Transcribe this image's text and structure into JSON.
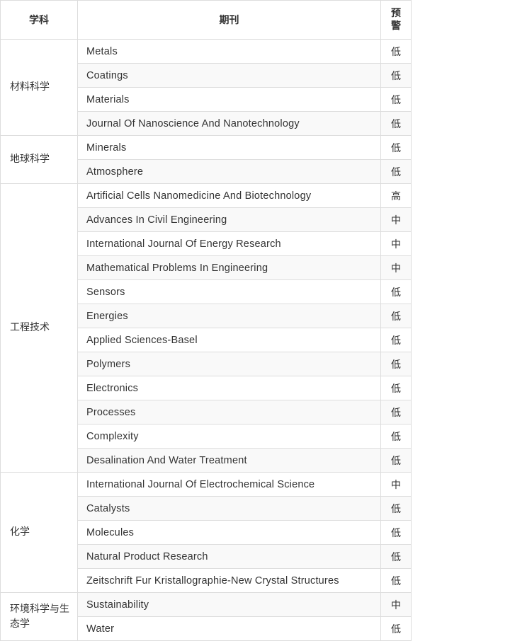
{
  "header": {
    "subject": "学科",
    "journal": "期刊",
    "warning": "预警"
  },
  "groups": [
    {
      "subject": "材料科学",
      "rows": [
        {
          "journal": "Metals",
          "level": "低"
        },
        {
          "journal": "Coatings",
          "level": "低"
        },
        {
          "journal": "Materials",
          "level": "低"
        },
        {
          "journal": "Journal Of Nanoscience And Nanotechnology",
          "level": "低"
        }
      ]
    },
    {
      "subject": "地球科学",
      "rows": [
        {
          "journal": "Minerals",
          "level": "低"
        },
        {
          "journal": "Atmosphere",
          "level": "低"
        }
      ]
    },
    {
      "subject": "工程技术",
      "rows": [
        {
          "journal": "Artificial Cells Nanomedicine And Biotechnology",
          "level": "高"
        },
        {
          "journal": "Advances In Civil Engineering",
          "level": "中"
        },
        {
          "journal": "International Journal Of Energy Research",
          "level": "中"
        },
        {
          "journal": "Mathematical Problems In Engineering",
          "level": "中"
        },
        {
          "journal": "Sensors",
          "level": "低"
        },
        {
          "journal": "Energies",
          "level": "低"
        },
        {
          "journal": "Applied Sciences-Basel",
          "level": "低"
        },
        {
          "journal": "Polymers",
          "level": "低"
        },
        {
          "journal": "Electronics",
          "level": "低"
        },
        {
          "journal": "Processes",
          "level": "低"
        },
        {
          "journal": "Complexity",
          "level": "低"
        },
        {
          "journal": "Desalination And Water Treatment",
          "level": "低"
        }
      ]
    },
    {
      "subject": "化学",
      "rows": [
        {
          "journal": "International Journal Of Electrochemical Science",
          "level": "中"
        },
        {
          "journal": "Catalysts",
          "level": "低"
        },
        {
          "journal": "Molecules",
          "level": "低"
        },
        {
          "journal": "Natural Product Research",
          "level": "低"
        },
        {
          "journal": "Zeitschrift Fur Kristallographie-New Crystal Structures",
          "level": "低"
        }
      ]
    },
    {
      "subject": "环境科学与生态学",
      "rows": [
        {
          "journal": "Sustainability",
          "level": "中"
        },
        {
          "journal": "Water",
          "level": "低"
        }
      ]
    }
  ]
}
